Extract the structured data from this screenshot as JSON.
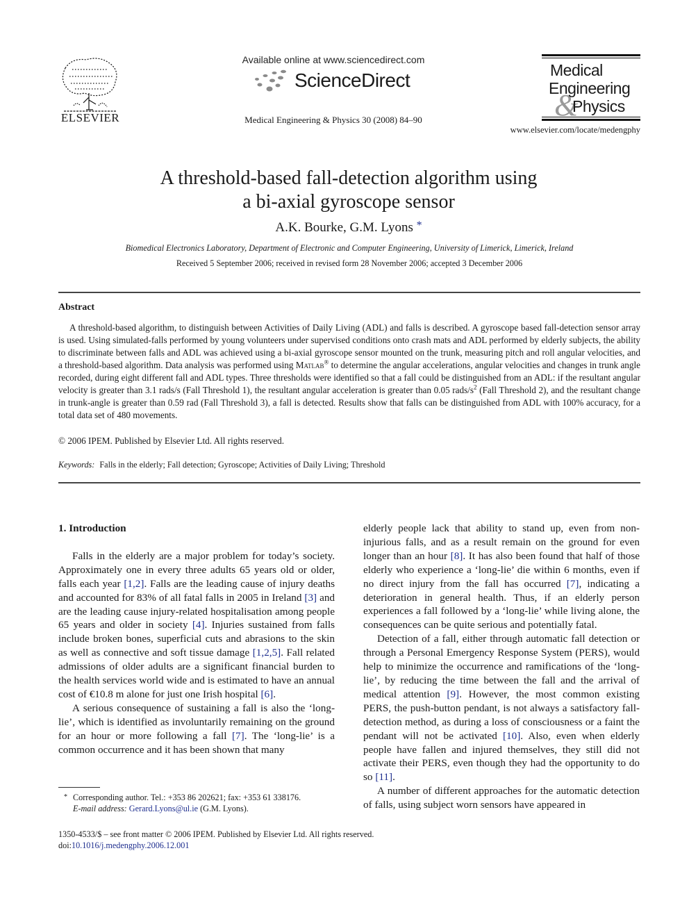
{
  "header": {
    "publisher_logo": "elsevier-tree-logo",
    "publisher_name": "ELSEVIER",
    "available_online": "Available online at www.sciencedirect.com",
    "platform_name": "ScienceDirect",
    "journal_citation": "Medical Engineering & Physics 30 (2008) 84–90",
    "journal_logo": {
      "line1": "Medical",
      "line2": "Engineering",
      "ampersand": "&",
      "line3": "Physics"
    },
    "journal_url": "www.elsevier.com/locate/medengphy"
  },
  "article": {
    "title_line1": "A threshold-based fall-detection algorithm using",
    "title_line2": "a bi-axial gyroscope sensor",
    "authors": "A.K. Bourke, G.M. Lyons",
    "author_mark": "*",
    "affiliation": "Biomedical Electronics Laboratory, Department of Electronic and Computer Engineering, University of Limerick, Limerick, Ireland",
    "received": "Received 5 September 2006; received in revised form 28 November 2006; accepted 3 December 2006"
  },
  "abstract": {
    "heading": "Abstract",
    "text_part1": "A threshold-based algorithm, to distinguish between Activities of Daily Living (ADL) and falls is described. A gyroscope based fall-detection sensor array is used. Using simulated-falls performed by young volunteers under supervised conditions onto crash mats and ADL performed by elderly subjects, the ability to discriminate between falls and ADL was achieved using a bi-axial gyroscope sensor mounted on the trunk, measuring pitch and roll angular velocities, and a threshold-based algorithm. Data analysis was performed using ",
    "software": "Matlab",
    "registered": "®",
    "text_part2": " to determine the angular accelerations, angular velocities and changes in trunk angle recorded, during eight different fall and ADL types. Three thresholds were identified so that a fall could be distinguished from an ADL: if the resultant angular velocity is greater than 3.1 rads/s (Fall Threshold 1), the resultant angular acceleration is greater than 0.05 rads/s",
    "superscript": "2",
    "text_part3": " (Fall Threshold 2), and the resultant change in trunk-angle is greater than 0.59 rad (Fall Threshold 3), a fall is detected. Results show that falls can be distinguished from ADL with 100% accuracy, for a total data set of 480 movements.",
    "copyright": "© 2006 IPEM. Published by Elsevier Ltd. All rights reserved."
  },
  "keywords": {
    "label": "Keywords:",
    "value": "Falls in the elderly; Fall detection; Gyroscope; Activities of Daily Living; Threshold"
  },
  "body": {
    "section_heading": "1.  Introduction",
    "left": {
      "p1_a": "Falls in the elderly are a major problem for today’s society. Approximately one in every three adults 65 years old or older, falls each year ",
      "ref_1_2": "[1,2]",
      "p1_b": ". Falls are the leading cause of injury deaths and accounted for 83% of all fatal falls in 2005 in Ireland ",
      "ref_3": "[3]",
      "p1_c": " and are the leading cause injury-related hospitalisation among people 65 years and older in society ",
      "ref_4": "[4]",
      "p1_d": ". Injuries sustained from falls include broken bones, superficial cuts and abrasions to the skin as well as connective and soft tissue damage ",
      "ref_1_2_5": "[1,2,5]",
      "p1_e": ". Fall related admissions of older adults are a significant financial burden to the health services world wide and is estimated to have an annual cost of €10.8 m alone for just one Irish hospital ",
      "ref_6": "[6]",
      "p1_f": ".",
      "p2_a": "A serious consequence of sustaining a fall is also the ‘long-lie’, which is identified as involuntarily remaining on the ground for an hour or more following a fall ",
      "ref_7": "[7]",
      "p2_b": ". The ‘long-lie’ is a common occurrence and it has been shown that many"
    },
    "right": {
      "p1_a": "elderly people lack that ability to stand up, even from non-injurious falls, and as a result remain on the ground for even longer than an hour ",
      "ref_8": "[8]",
      "p1_b": ". It has also been found that half of those elderly who experience a ‘long-lie’ die within 6 months, even if no direct injury from the fall has occurred ",
      "ref_7": "[7]",
      "p1_c": ", indicating a deterioration in general health. Thus, if an elderly person experiences a fall followed by a ‘long-lie’ while living alone, the consequences can be quite serious and potentially fatal.",
      "p2_a": "Detection of a fall, either through automatic fall detection or through a Personal Emergency Response System (PERS), would help to minimize the occurrence and ramifications of the ‘long-lie’, by reducing the time between the fall and the arrival of medical attention ",
      "ref_9": "[9]",
      "p2_b": ". However, the most common existing PERS, the push-button pendant, is not always a satisfactory fall-detection method, as during a loss of consciousness or a faint the pendant will not be activated ",
      "ref_10": "[10]",
      "p2_c": ". Also, even when elderly people have fallen and injured themselves, they still did not activate their PERS, even though they had the opportunity to do so ",
      "ref_11": "[11]",
      "p2_d": ".",
      "p3": "A number of different approaches for the automatic detection of falls, using subject worn sensors have appeared in"
    }
  },
  "footnote": {
    "mark": "*",
    "line1": "Corresponding author. Tel.: +353 86 202621; fax: +353 61 338176.",
    "email_label": "E-mail address:",
    "email": "Gerard.Lyons@ul.ie",
    "email_suffix": " (G.M. Lyons)."
  },
  "front_matter": {
    "issn_line": "1350-4533/$ – see front matter © 2006 IPEM. Published by Elsevier Ltd. All rights reserved.",
    "doi_label": "doi:",
    "doi": "10.1016/j.medengphy.2006.12.001"
  },
  "colors": {
    "link": "#1f2f8f",
    "text": "#1a1a1a",
    "ampersand": "#9a9a9a"
  }
}
